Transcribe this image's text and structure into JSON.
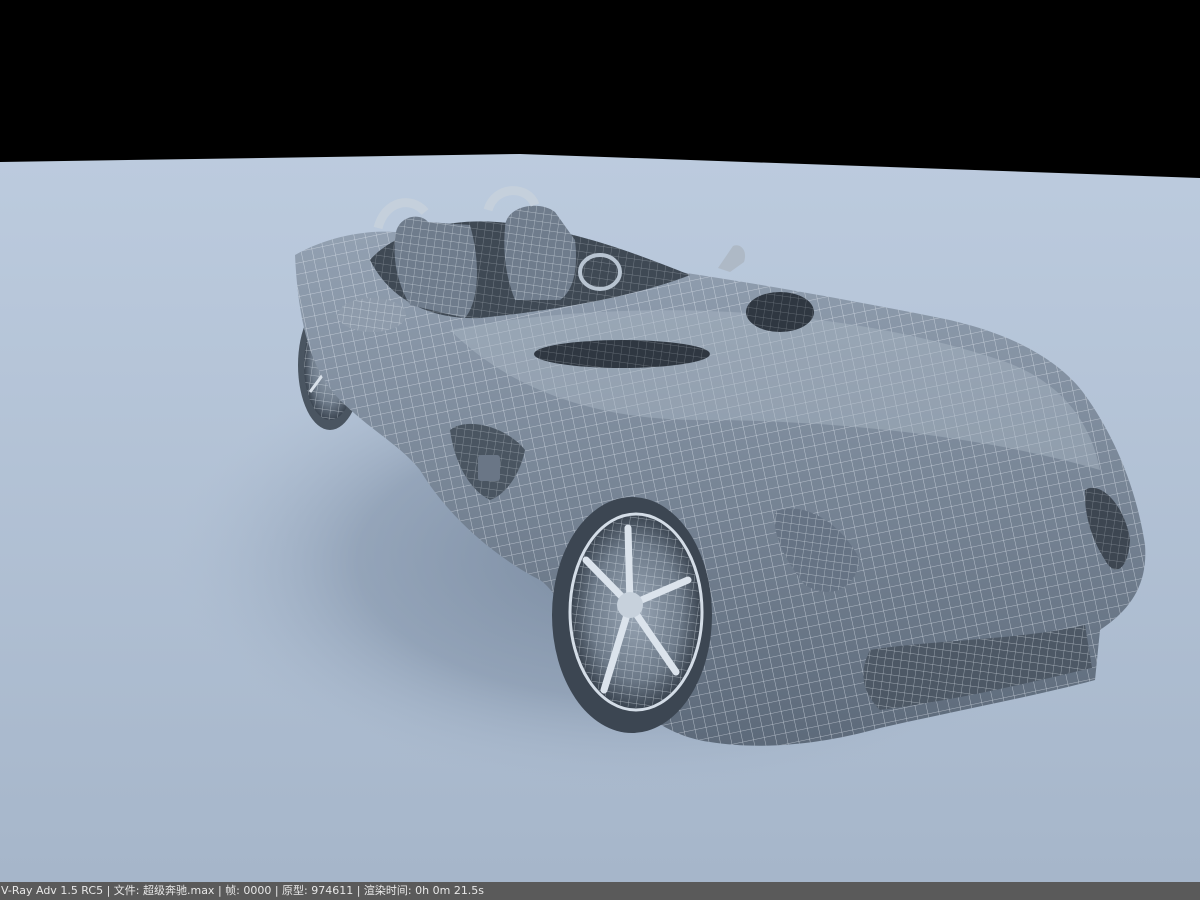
{
  "render": {
    "subject": "wireframe roadster car on ground plane",
    "colors": {
      "sky": "#000000",
      "ground_far": "#b9c8db",
      "ground_near": "#a8b8cc",
      "shadow": "#7e8fa4",
      "body": "#7d8b9c",
      "body_dark": "#4f5b69",
      "wire": "#dfe7f0",
      "tire": "#3c4652"
    }
  },
  "status_bar": {
    "text": "V-Ray Adv 1.5 RC5 | 文件: 超级奔驰.max | 帧: 0000 | 原型: 974611 | 渲染时间: 0h 0m 21.5s",
    "background": "#5a5a5a",
    "text_color": "#e8e8e8"
  }
}
